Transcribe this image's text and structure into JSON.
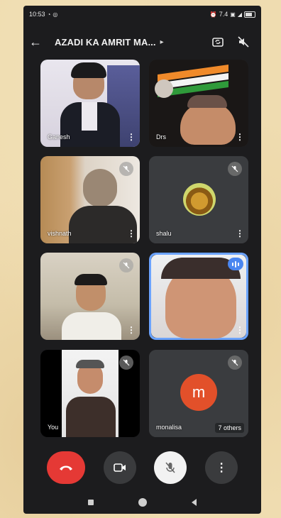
{
  "status_bar": {
    "time": "10:53",
    "left_icons": [
      "signal-activity-icon",
      "whatsapp-icon"
    ],
    "right_text": "7.4",
    "right_icons": [
      "alarm-icon",
      "volte-icon",
      "signal-icon",
      "battery-icon"
    ]
  },
  "header": {
    "back_icon": "back-arrow-icon",
    "title": "AZADI KA AMRIT MA...",
    "caret": "▸",
    "switch_camera_icon": "switch-camera-icon",
    "audio_off_icon": "speaker-off-icon"
  },
  "tiles": [
    {
      "name": "Ganesh",
      "state": "video"
    },
    {
      "name": "Drs",
      "state": "video"
    },
    {
      "name": "vishnath",
      "state": "video"
    },
    {
      "name": "shalu",
      "state": "avatar"
    },
    {
      "name": "",
      "state": "video"
    },
    {
      "name": "",
      "state": "video",
      "speaking": true
    },
    {
      "name": "You",
      "state": "video"
    },
    {
      "name": "monalisa",
      "state": "avatar",
      "initial": "m",
      "others": "7 others"
    }
  ],
  "controls": {
    "end_call_icon": "end-call-icon",
    "camera_icon": "camera-icon",
    "mic_icon": "mic-off-icon",
    "more_icon": "more-vertical-icon",
    "more_label": "⋮"
  },
  "nav": {
    "recent_icon": "recent-apps-icon",
    "home_icon": "home-icon",
    "back_icon": "back-triangle-icon"
  },
  "colors": {
    "end_call": "#e53935",
    "speaking_border": "#6ba3ff",
    "avatar_m": "#e2502a"
  }
}
